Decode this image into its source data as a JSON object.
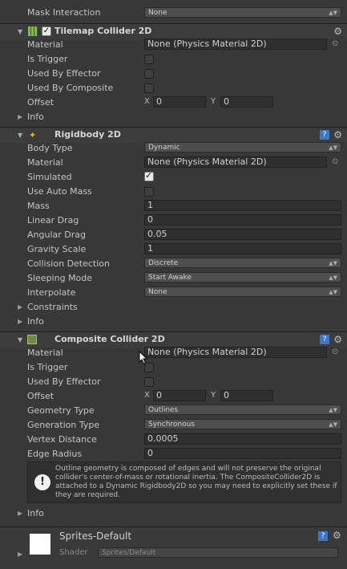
{
  "top": {
    "mask_label": "Mask Interaction",
    "mask_value": "None"
  },
  "tilemap": {
    "title": "Tilemap Collider 2D",
    "material_label": "Material",
    "material_value": "None (Physics Material 2D)",
    "is_trigger": "Is Trigger",
    "used_by_effector": "Used By Effector",
    "used_by_composite": "Used By Composite",
    "offset": "Offset",
    "x": "X",
    "y": "Y",
    "offset_x": "0",
    "offset_y": "0",
    "info": "Info"
  },
  "rigidbody": {
    "title": "Rigidbody 2D",
    "body_type_label": "Body Type",
    "body_type_value": "Dynamic",
    "material_label": "Material",
    "material_value": "None (Physics Material 2D)",
    "simulated": "Simulated",
    "use_auto_mass": "Use Auto Mass",
    "mass_label": "Mass",
    "mass": "1",
    "linear_drag_label": "Linear Drag",
    "linear_drag": "0",
    "angular_drag_label": "Angular Drag",
    "angular_drag": "0.05",
    "gravity_label": "Gravity Scale",
    "gravity": "1",
    "collision_label": "Collision Detection",
    "collision": "Discrete",
    "sleeping_label": "Sleeping Mode",
    "sleeping": "Start Awake",
    "interpolate_label": "Interpolate",
    "interpolate": "None",
    "constraints": "Constraints",
    "info": "Info"
  },
  "composite": {
    "title": "Composite Collider 2D",
    "material_label": "Material",
    "material_value": "None (Physics Material 2D)",
    "is_trigger": "Is Trigger",
    "used_by_effector": "Used By Effector",
    "offset": "Offset",
    "x": "X",
    "y": "Y",
    "offset_x": "0",
    "offset_y": "0",
    "geometry_label": "Geometry Type",
    "geometry": "Outlines",
    "generation_label": "Generation Type",
    "generation": "Synchronous",
    "vertex_label": "Vertex Distance",
    "vertex": "0.0005",
    "edge_label": "Edge Radius",
    "edge": "0",
    "warning": "Outline geometry is composed of edges and will not preserve the original collider's center-of-mass or rotational inertia.  The CompositeCollider2D is attached to a Dynamic Rigidbody2D so you may need to explicitly set these if they are required.",
    "info": "Info"
  },
  "material_asset": {
    "name": "Sprites-Default",
    "shader_label": "Shader",
    "shader_value": "Sprites/Default"
  },
  "icons": {
    "gear": "⚙",
    "book": "?",
    "target": "⊙",
    "warning": "!"
  }
}
